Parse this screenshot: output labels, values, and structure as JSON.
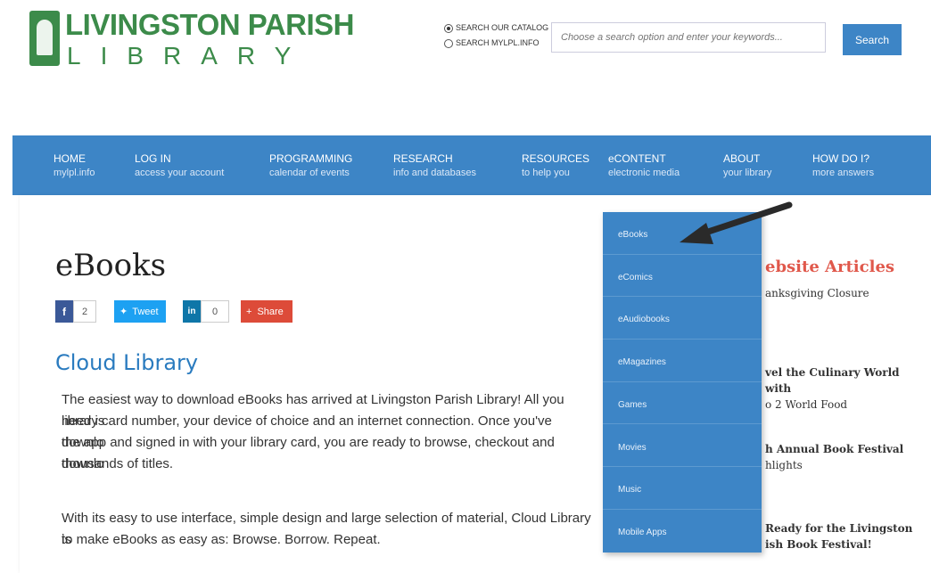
{
  "header": {
    "logo_line1": "LIVINGSTON PARISH",
    "logo_line2": "LIBRARY",
    "search_options": [
      "SEARCH OUR CATALOG",
      "SEARCH MYLPL.INFO"
    ],
    "search_placeholder": "Choose a search option and enter your keywords...",
    "search_button": "Search"
  },
  "nav": [
    {
      "title": "HOME",
      "sub": "mylpl.info"
    },
    {
      "title": "LOG IN",
      "sub": "access your account"
    },
    {
      "title": "PROGRAMMING",
      "sub": "calendar of events"
    },
    {
      "title": "RESEARCH",
      "sub": "info and databases"
    },
    {
      "title": "RESOURCES",
      "sub": "to help you"
    },
    {
      "title": "eCONTENT",
      "sub": "electronic media"
    },
    {
      "title": "ABOUT",
      "sub": "your library"
    },
    {
      "title": "HOW DO I?",
      "sub": "more answers"
    }
  ],
  "page": {
    "title": "eBooks",
    "social": {
      "fb_count": "2",
      "tweet": "Tweet",
      "in_count": "0",
      "share": "Share"
    },
    "section_title": "Cloud Library",
    "para1_lines": [
      "The easiest way to download eBooks has arrived at Livingston Parish Library! All you need is",
      "library card number, your device of choice and an internet connection. Once you've downlo",
      "the app and signed in with your library card, you are ready to browse, checkout and downlo",
      "thousands of titles."
    ],
    "para2_lines": [
      "With its easy to use interface, simple design and large selection of material, Cloud Library is",
      "to make eBooks as easy as: Browse. Borrow. Repeat."
    ]
  },
  "sidebar": {
    "title": "ebsite Articles",
    "items": [
      [
        "anksgiving Closure"
      ],
      [
        "vel the Culinary World with",
        "o 2 World Food"
      ],
      [
        "h Annual Book Festival",
        "hlights"
      ],
      [
        "Ready for the Livingston",
        "ish Book Festival!"
      ]
    ]
  },
  "dropdown": [
    "eBooks",
    "eComics",
    "eAudiobooks",
    "eMagazines",
    "Games",
    "Movies",
    "Music",
    "Mobile Apps"
  ],
  "colors": {
    "brand_green": "#3c8b4a",
    "nav_blue": "#3d85c6",
    "link_blue": "#2a7bbf",
    "sidebar_red": "#e0584b"
  }
}
